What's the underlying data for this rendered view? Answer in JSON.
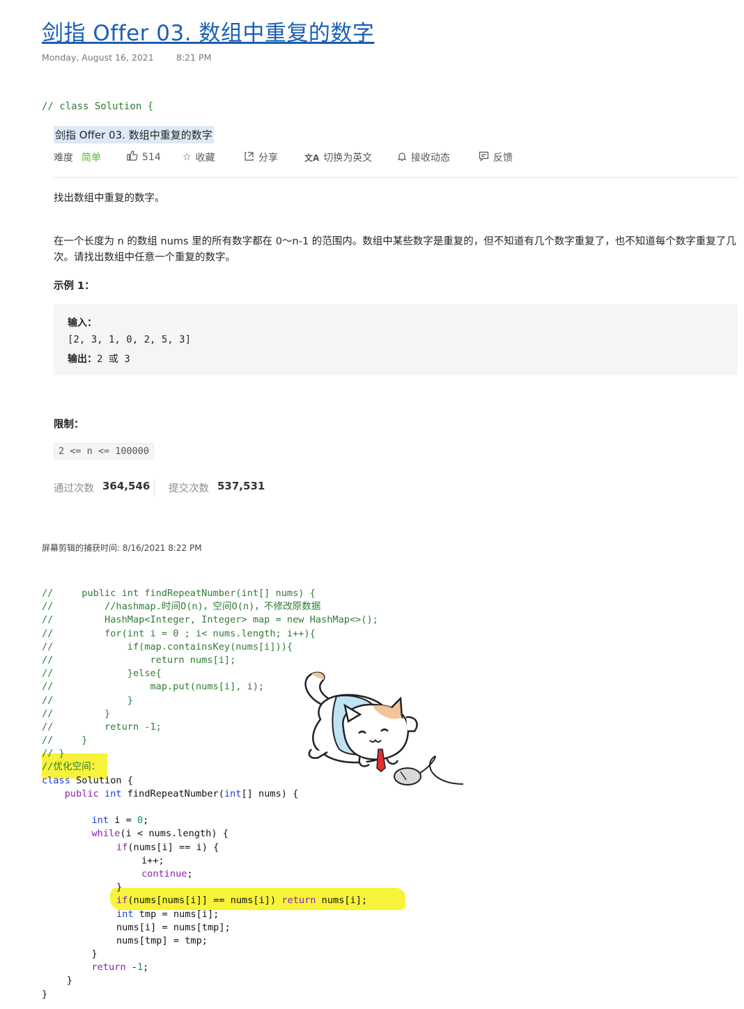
{
  "header": {
    "title": "剑指 Offer 03. 数组中重复的数字",
    "date": "Monday, August 16, 2021",
    "time": "8:21 PM"
  },
  "comment_top": "// class Solution {",
  "problem": {
    "title": "剑指 Offer 03. 数组中重复的数字",
    "meta": {
      "difficulty_label": "难度",
      "difficulty_value": "简单",
      "likes": "514",
      "collect": "收藏",
      "share": "分享",
      "switch_lang": "切换为英文",
      "notify": "接收动态",
      "feedback": "反馈",
      "icons": [
        "thumbs-up-icon",
        "star-icon",
        "share-icon",
        "translate-icon",
        "bell-icon",
        "feedback-icon"
      ]
    },
    "description_1": "找出数组中重复的数字。",
    "description_2": "在一个长度为 n 的数组 nums 里的所有数字都在 0～n-1 的范围内。数组中某些数字是重复的，但不知道有几个数字重复了，也不知道每个数字重复了几次。请找出数组中任意一个重复的数字。",
    "example_heading": "示例 1：",
    "example": {
      "input_label": "输入：",
      "input_value": "[2, 3, 1, 0, 2, 5, 3]",
      "output_label": "输出：",
      "output_value": "2 或 3"
    },
    "limit_heading": "限制：",
    "limit_code": "2 <= n <= 100000",
    "stats": {
      "accepted_label": "通过次数",
      "accepted_value": "364,546",
      "submissions_label": "提交次数",
      "submissions_value": "537,531"
    }
  },
  "capture_note": "屏幕剪辑的捕获时间: 8/16/2021 8:22 PM",
  "code_lines": {
    "c1": "//     public int findRepeatNumber(int[] nums) {",
    "c2": "//         //hashmap.时间O(n)，空间O(n)，不修改原数据",
    "c3": "//         HashMap<Integer, Integer> map = new HashMap<>();",
    "c4": "//         for(int i = 0 ; i< nums.length; i++){",
    "c5": "//             if(map.containsKey(nums[i])){",
    "c6": "//                 return nums[i];",
    "c7": "//             }else{",
    "c8": "//                 map.put(nums[i], i);",
    "c9": "//             }",
    "c10": "//         }",
    "c11": "//         return -1;",
    "c12": "//     }",
    "c13": "// }",
    "c14": "//优化空间：",
    "l1_kw": "class",
    "l1_name": " Solution {",
    "l2_indent": "    ",
    "l2_kw": "public",
    "l2_kw2": " int",
    "l2_rest": " findRepeatNumber(",
    "l2_kw3": "int",
    "l2_rest2": "[] nums) {",
    "l4_kw": "int",
    "l4_rest": " i = ",
    "l4_num": "0",
    "l4_end": ";",
    "l5_kw": "while",
    "l5_rest": "(i < nums.length) {",
    "l6_kw": "if",
    "l6_rest": "(nums[i] == i) {",
    "l7": "i++;",
    "l8_kw": "continue",
    "l8_end": ";",
    "l9": "}",
    "l10_kw": "if",
    "l10_rest": "(nums[nums[i]] == nums[i]) ",
    "l10_kw2": "return",
    "l10_end": " nums[i];",
    "l11_kw": "int",
    "l11_rest": " tmp = nums[i];",
    "l12": "nums[i] = nums[tmp];",
    "l13": "nums[tmp] = tmp;",
    "l14": "}",
    "l15_kw": "return",
    "l15_rest": " -",
    "l15_num": "1",
    "l15_end": ";",
    "l16": "}",
    "l17": "}"
  },
  "colors": {
    "title_link": "#1a5fb4",
    "comment_green": "#2e7d32",
    "keyword_blue": "#1f3bd8",
    "keyword_purple": "#8a1fb0",
    "highlight_yellow": "#f7f33a",
    "easy_green": "#5ab726"
  }
}
